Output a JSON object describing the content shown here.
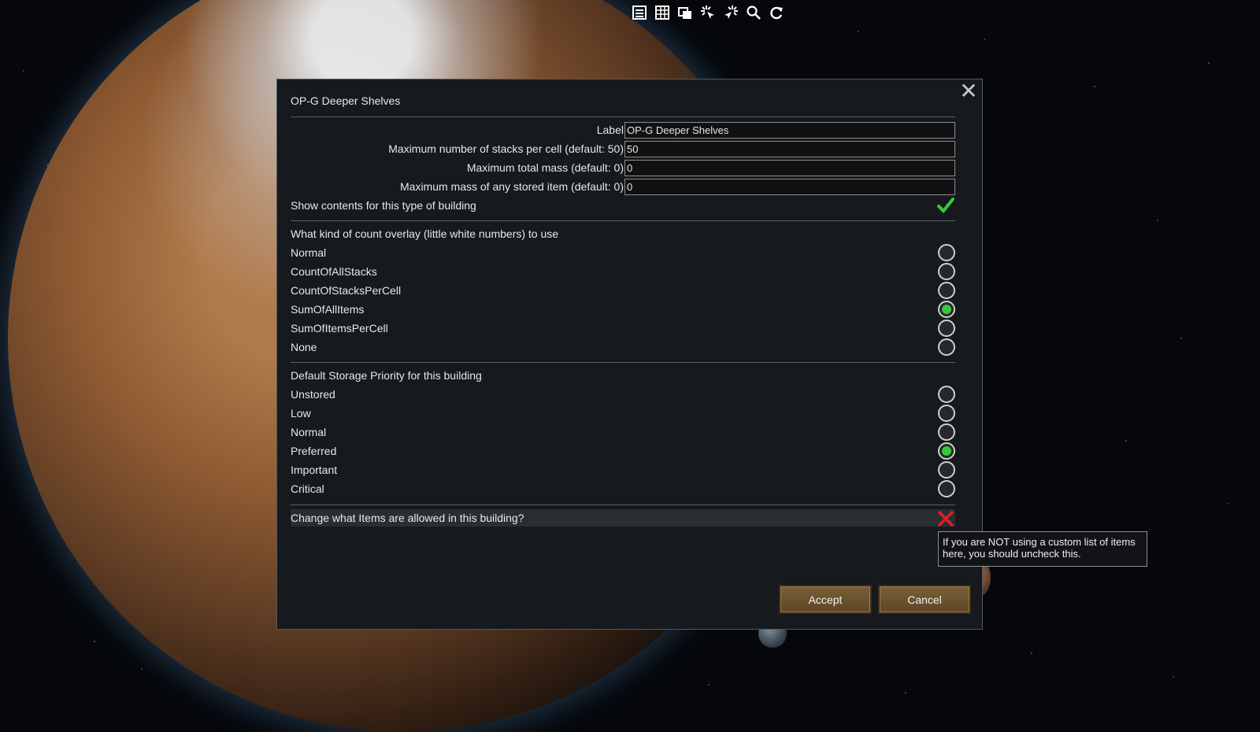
{
  "toolbar": {
    "icons": [
      "list-icon",
      "table-icon",
      "windows-icon",
      "cursor-sparkle-icon",
      "cursor-sparkle-alt-icon",
      "search-icon",
      "refresh-icon"
    ]
  },
  "dialog": {
    "title": "OP-G Deeper Shelves",
    "close_glyph": "✕",
    "fields": [
      {
        "label": "Label",
        "value": "OP-G Deeper Shelves"
      },
      {
        "label": "Maximum number of stacks per cell (default: 50)",
        "value": "50"
      },
      {
        "label": "Maximum total mass (default: 0)",
        "value": "0"
      },
      {
        "label": "Maximum mass of any stored item (default: 0)",
        "value": "0"
      }
    ],
    "show_contents": {
      "label": "Show contents for this type of building",
      "checked": true
    },
    "overlay": {
      "heading": "What kind of count overlay (little white numbers) to use",
      "options": [
        "Normal",
        "CountOfAllStacks",
        "CountOfStacksPerCell",
        "SumOfAllItems",
        "SumOfItemsPerCell",
        "None"
      ],
      "selected": "SumOfAllItems"
    },
    "priority": {
      "heading": "Default Storage Priority for this building",
      "options": [
        "Unstored",
        "Low",
        "Normal",
        "Preferred",
        "Important",
        "Critical"
      ],
      "selected": "Preferred"
    },
    "change_items": {
      "label": "Change what Items are allowed in this building?",
      "checked": false
    },
    "tooltip": "If you are NOT using a custom list of items here, you should uncheck this.",
    "accept_label": "Accept",
    "cancel_label": "Cancel"
  },
  "colors": {
    "selected_radio": "#36c93a",
    "check": "#36c93a",
    "x_mark": "#e02020",
    "button": "#6b5230"
  }
}
